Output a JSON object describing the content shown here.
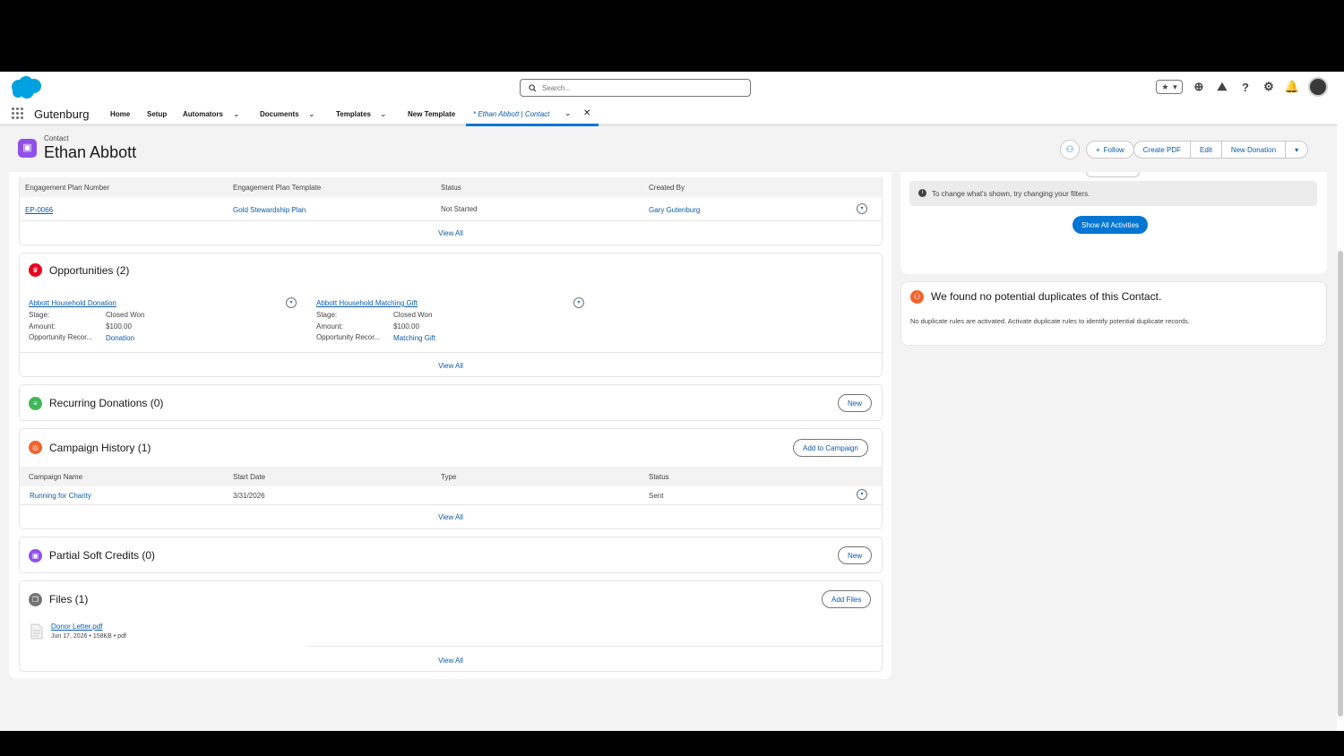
{
  "colors": {
    "brand": "#0176d3",
    "link": "#0b5cab",
    "contact": "#9050e9",
    "opportunity": "#ea001e",
    "recurring": "#41b658",
    "campaign": "#f4622a",
    "files": "#747474"
  },
  "topbar": {
    "search_placeholder": "Search..."
  },
  "nav": {
    "app_name": "Gutenburg",
    "items": [
      "Home",
      "Setup",
      "Automators",
      "Documents",
      "Templates",
      "New Template"
    ],
    "active_tab": "* Ethan Abbott | Contact"
  },
  "header": {
    "object_label": "Contact",
    "record_name": "Ethan Abbott",
    "buttons": {
      "follow": "Follow",
      "create_pdf": "Create PDF",
      "edit": "Edit",
      "new_donation": "New Donation"
    }
  },
  "engagement": {
    "columns": [
      "Engagement Plan Number",
      "Engagement Plan Template",
      "Status",
      "Created By"
    ],
    "row": {
      "number": "EP-0066",
      "template": "Gold Stewardship Plan",
      "status": "Not Started",
      "created_by": "Gary Gutenburg"
    },
    "view_all": "View All"
  },
  "opportunities": {
    "title": "Opportunities (2)",
    "labels": {
      "stage": "Stage:",
      "amount": "Amount:",
      "record_type": "Opportunity Recor..."
    },
    "items": [
      {
        "name": "Abbott Household Donation",
        "stage": "Closed Won",
        "amount": "$100.00",
        "record_type": "Donation"
      },
      {
        "name": "Abbott Household Matching Gift",
        "stage": "Closed Won",
        "amount": "$100.00",
        "record_type": "Matching Gift"
      }
    ],
    "view_all": "View All"
  },
  "recurring": {
    "title": "Recurring Donations (0)",
    "button": "New"
  },
  "campaign": {
    "title": "Campaign History (1)",
    "button": "Add to Campaign",
    "columns": [
      "Campaign Name",
      "Start Date",
      "Type",
      "Status"
    ],
    "row": {
      "name": "Running for Charity",
      "start_date": "3/31/2026",
      "type": "",
      "status": "Sent"
    },
    "view_all": "View All"
  },
  "soft_credits": {
    "title": "Partial Soft Credits (0)",
    "button": "New"
  },
  "files": {
    "title": "Files (1)",
    "button": "Add Files",
    "file": {
      "name": "Donor Letter.pdf",
      "meta": "Jun 17, 2026 • 158KB • pdf"
    },
    "view_all": "View All"
  },
  "activity": {
    "filter_note": "To change what's shown, try changing your filters.",
    "show_all": "Show All Activities"
  },
  "duplicates": {
    "title": "We found no potential duplicates of this Contact.",
    "body": "No duplicate rules are activated. Activate duplicate rules to identify potential duplicate records."
  }
}
